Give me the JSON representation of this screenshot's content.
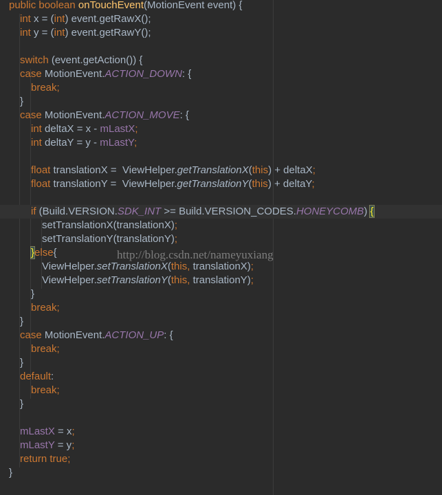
{
  "watermark": "http://blog.csdn.net/nameyuxiang",
  "colors": {
    "background": "#2b2b2b",
    "keyword": "#cc7832",
    "method_declaration": "#ffc66d",
    "field": "#9876aa",
    "text": "#a9b7c6"
  },
  "code": {
    "lines": [
      [
        [
          "kw",
          "public boolean "
        ],
        [
          "fn",
          "onTouchEvent"
        ],
        [
          "p",
          "(MotionEvent event) {"
        ]
      ],
      [
        [
          "kw",
          "int "
        ],
        [
          "p",
          "x = ("
        ],
        [
          "kw",
          "int"
        ],
        [
          "p",
          ") event.getRawX();"
        ]
      ],
      [
        [
          "kw",
          "int "
        ],
        [
          "p",
          "y = ("
        ],
        [
          "kw",
          "int"
        ],
        [
          "p",
          ") event.getRawY();"
        ]
      ],
      [],
      [
        [
          "kw",
          "switch "
        ],
        [
          "p",
          "(event.getAction()) {"
        ]
      ],
      [
        [
          "kw",
          "case "
        ],
        [
          "p",
          "MotionEvent."
        ],
        [
          "st",
          "ACTION_DOWN"
        ],
        [
          "p",
          ": {"
        ]
      ],
      [
        [
          "kw",
          "break"
        ],
        [
          "kw",
          ";"
        ]
      ],
      [
        [
          "p",
          "}"
        ]
      ],
      [
        [
          "kw",
          "case "
        ],
        [
          "p",
          "MotionEvent."
        ],
        [
          "st",
          "ACTION_MOVE"
        ],
        [
          "p",
          ": {"
        ]
      ],
      [
        [
          "kw",
          "int "
        ],
        [
          "p",
          "deltaX = x - "
        ],
        [
          "f",
          "mLastX"
        ],
        [
          "kw",
          ";"
        ]
      ],
      [
        [
          "kw",
          "int "
        ],
        [
          "p",
          "deltaY = y - "
        ],
        [
          "f",
          "mLastY"
        ],
        [
          "kw",
          ";"
        ]
      ],
      [],
      [
        [
          "kw",
          "float "
        ],
        [
          "p",
          "translationX =  ViewHelper."
        ],
        [
          "it",
          "getTranslationX"
        ],
        [
          "p",
          "("
        ],
        [
          "kw",
          "this"
        ],
        [
          "p",
          ") + deltaX"
        ],
        [
          "kw",
          ";"
        ]
      ],
      [
        [
          "kw",
          "float "
        ],
        [
          "p",
          "translationY =  ViewHelper."
        ],
        [
          "it",
          "getTranslationY"
        ],
        [
          "p",
          "("
        ],
        [
          "kw",
          "this"
        ],
        [
          "p",
          ") + deltaY"
        ],
        [
          "kw",
          ";"
        ]
      ],
      [],
      [
        [
          "kw",
          "if "
        ],
        [
          "p",
          "(Build.VERSION."
        ],
        [
          "st",
          "SDK_INT "
        ],
        [
          "p",
          ">= Build.VERSION_CODES."
        ],
        [
          "st",
          "HONEYCOMB"
        ],
        [
          "p",
          ") "
        ],
        [
          "bm",
          "{"
        ]
      ],
      [
        [
          "p",
          "setTranslationX(translationX)"
        ],
        [
          "kw",
          ";"
        ]
      ],
      [
        [
          "p",
          "setTranslationY(translationY)"
        ],
        [
          "kw",
          ";"
        ]
      ],
      [
        [
          "bm",
          "}"
        ],
        [
          "kw",
          "else"
        ],
        [
          "p",
          "{"
        ]
      ],
      [
        [
          "p",
          "ViewHelper."
        ],
        [
          "it",
          "setTranslationX"
        ],
        [
          "p",
          "("
        ],
        [
          "kw",
          "this, "
        ],
        [
          "p",
          "translationX)"
        ],
        [
          "kw",
          ";"
        ]
      ],
      [
        [
          "p",
          "ViewHelper."
        ],
        [
          "it",
          "setTranslationY"
        ],
        [
          "p",
          "("
        ],
        [
          "kw",
          "this, "
        ],
        [
          "p",
          "translationY)"
        ],
        [
          "kw",
          ";"
        ]
      ],
      [
        [
          "p",
          "}"
        ]
      ],
      [
        [
          "kw",
          "break"
        ],
        [
          "kw",
          ";"
        ]
      ],
      [
        [
          "p",
          "}"
        ]
      ],
      [
        [
          "kw",
          "case "
        ],
        [
          "p",
          "MotionEvent."
        ],
        [
          "st",
          "ACTION_UP"
        ],
        [
          "p",
          ": {"
        ]
      ],
      [
        [
          "kw",
          "break"
        ],
        [
          "kw",
          ";"
        ]
      ],
      [
        [
          "p",
          "}"
        ]
      ],
      [
        [
          "kw",
          "default"
        ],
        [
          "p",
          ":"
        ]
      ],
      [
        [
          "kw",
          "break"
        ],
        [
          "kw",
          ";"
        ]
      ],
      [
        [
          "p",
          "}"
        ]
      ],
      [],
      [
        [
          "f",
          "mLastX "
        ],
        [
          "p",
          "= x"
        ],
        [
          "kw",
          ";"
        ]
      ],
      [
        [
          "f",
          "mLastY "
        ],
        [
          "p",
          "= y"
        ],
        [
          "kw",
          ";"
        ]
      ],
      [
        [
          "kw",
          "return true;"
        ]
      ],
      [
        [
          "p",
          "}"
        ]
      ]
    ]
  }
}
